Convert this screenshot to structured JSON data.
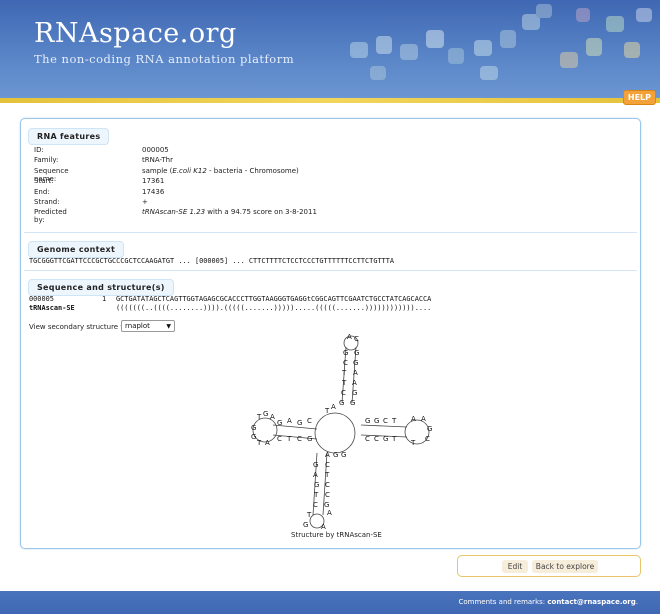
{
  "header": {
    "title": "RNAspace.org",
    "subtitle": "The non-coding RNA annotation platform",
    "help_label": "HELP"
  },
  "features": {
    "heading": "RNA features",
    "rows": [
      {
        "label": "ID:",
        "value": "000005"
      },
      {
        "label": "Family:",
        "value": "tRNA-Thr"
      },
      {
        "label": "Sequence name:",
        "value_prefix": "sample (",
        "value_italic": "E.coli K12",
        "value_suffix": " - bacteria - Chromosome)"
      },
      {
        "label": "Start:",
        "value": "17361"
      },
      {
        "label": "End:",
        "value": "17436"
      },
      {
        "label": "Strand:",
        "value": "+"
      },
      {
        "label": "Predicted by:",
        "value_italic": "tRNAscan-SE 1.23",
        "value_suffix": " with a 94.75 score on 3-8-2011"
      }
    ]
  },
  "genome": {
    "heading": "Genome context",
    "line": "TGCGGGTTCGATTCCCGCTGCCCGCTCCAAGATGT ... [000005] ... CTTCTTTTCTCCTCCCTGTTTTTTCCTTCTGTTTA"
  },
  "structure": {
    "heading": "Sequence and structure(s)",
    "seq_id": "000005",
    "seq_pos": "1",
    "sequence": "GCTGATATAGCTCAGTTGGTAGAGCGCACCCTTGGTAAGGGTGAGGtCGGCAGTTCGAATCTGCCTATCAGCACCA",
    "tool_name": "tRNAscan-SE",
    "dotbracket": "(((((((..((((........)))).(((((.......))))).....(((((.......))))))))))))....",
    "view_label": "View secondary structure with",
    "view_option": "rnaplot",
    "caption": "Structure by tRNAscan-SE"
  },
  "actions": {
    "edit_label": "Edit",
    "back_label": "Back to explore"
  },
  "footer": {
    "prefix": "Comments and remarks: ",
    "email": "contact@rnaspace.org",
    "suffix": "."
  },
  "colors": {
    "header_blue": "#3f67b3",
    "accent_yellow": "#e4c23a",
    "help_orange": "#f3a23a",
    "panel_border": "#9cc6e8"
  }
}
